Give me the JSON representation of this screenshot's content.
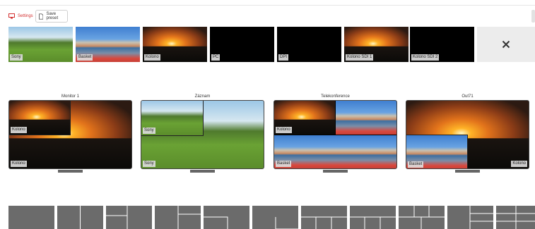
{
  "toolbar": {
    "settings_label": "Settings",
    "save_preset_label": "Save preset",
    "accent_color": "#d32f2f"
  },
  "sources": [
    {
      "label": "Sony",
      "kind": "field"
    },
    {
      "label": "Basket",
      "kind": "court"
    },
    {
      "label": "Kolono",
      "kind": "sunset"
    },
    {
      "label": "PC",
      "kind": "black"
    },
    {
      "label": "DPI",
      "kind": "black"
    },
    {
      "label": "Kolono SDI 1",
      "kind": "sunset"
    },
    {
      "label": "Kolono SDI 2",
      "kind": "black"
    }
  ],
  "close_icon": "close-icon",
  "outputs": [
    {
      "title": "Monitor 1",
      "pip_label": "Kolono",
      "main_label": "Kolono"
    },
    {
      "title": "Záznam",
      "pip_label": "Sony",
      "main_label": "Sony"
    },
    {
      "title": "Telekonference",
      "main_label": "Kolono",
      "bottom_label": "Basket"
    },
    {
      "title": "Out71",
      "pip_label": "Basket",
      "main_label": "Kolono"
    }
  ]
}
